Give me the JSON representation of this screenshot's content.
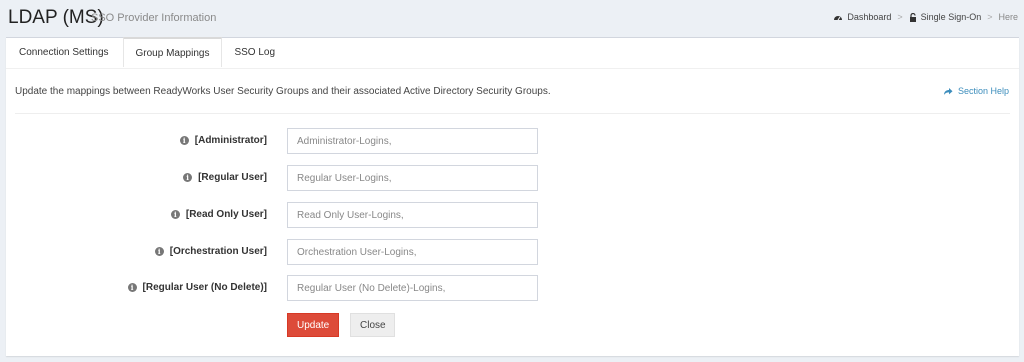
{
  "header": {
    "title": "LDAP (MS)",
    "subtitle": "SSO Provider Information"
  },
  "breadcrumb": {
    "items": [
      {
        "label": "Dashboard",
        "icon": "dashboard-icon"
      },
      {
        "label": "Single Sign-On",
        "icon": "unlock-icon"
      },
      {
        "label": "Here",
        "icon": ""
      }
    ]
  },
  "tabs": [
    {
      "label": "Connection Settings",
      "active": false
    },
    {
      "label": "Group Mappings",
      "active": true
    },
    {
      "label": "SSO Log",
      "active": false
    }
  ],
  "description": "Update the mappings between ReadyWorks User Security Groups and their associated Active Directory Security Groups.",
  "section_help": {
    "label": "Section Help",
    "icon": "share-icon"
  },
  "mappings": [
    {
      "label": "[Administrator]",
      "value": "",
      "placeholder": "Administrator-Logins,"
    },
    {
      "label": "[Regular User]",
      "value": "",
      "placeholder": "Regular User-Logins,"
    },
    {
      "label": "[Read Only User]",
      "value": "",
      "placeholder": "Read Only User-Logins,"
    },
    {
      "label": "[Orchestration User]",
      "value": "",
      "placeholder": "Orchestration User-Logins,"
    },
    {
      "label": "[Regular User (No Delete)]",
      "value": "",
      "placeholder": "Regular User (No Delete)-Logins,"
    }
  ],
  "buttons": {
    "update_label": "Update",
    "close_label": "Close"
  },
  "colors": {
    "accent_link": "#3c8dbc",
    "update_button": "#dd4b39",
    "background": "#ecf0f5"
  }
}
